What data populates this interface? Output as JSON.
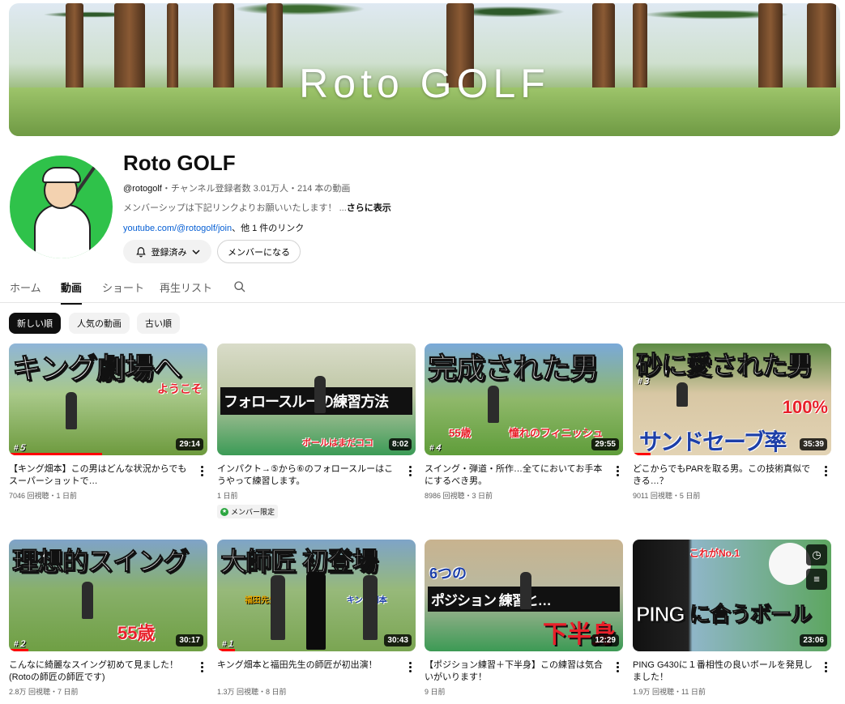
{
  "banner": {
    "title": "Roto GOLF"
  },
  "channel": {
    "name": "Roto GOLF",
    "handle": "@rotogolf",
    "stats": "・チャンネル登録者数 3.01万人・214 本の動画",
    "description": "メンバーシップは下記リンクよりお願いいたします！ ...",
    "more_label": "さらに表示",
    "link_url": "youtube.com/@rotogolf/join",
    "link_suffix": "、他 1 件のリンク",
    "subscribed_label": "登録済み",
    "member_label": "メンバーになる"
  },
  "tabs": [
    {
      "label": "ホーム",
      "active": false
    },
    {
      "label": "動画",
      "active": true
    },
    {
      "label": "ショート",
      "active": false
    },
    {
      "label": "再生リスト",
      "active": false
    }
  ],
  "chips": [
    {
      "label": "新しい順",
      "active": true
    },
    {
      "label": "人気の動画",
      "active": false
    },
    {
      "label": "古い順",
      "active": false
    }
  ],
  "videos": [
    {
      "thumb_text": "キング劇場へ",
      "thumb_sub": "ようこそ",
      "episode": "#５",
      "duration": "29:14",
      "title": "【キング畑本】この男はどんな状況からでもスーパーショットで…",
      "meta": "7046 回視聴・1 日前",
      "badge": ""
    },
    {
      "thumb_text": "フォロースルーの練習方法",
      "thumb_sub": "ボールはまだココ",
      "episode": "",
      "duration": "8:02",
      "title": "インパクト→⑤から⑥のフォロースルーはこうやって練習します。",
      "meta": "1 日前",
      "badge": "メンバー限定"
    },
    {
      "thumb_text": "完成された男",
      "thumb_sub": "憧れのフィニッシュ",
      "thumb_sub2": "55歳",
      "episode": "#４",
      "duration": "29:55",
      "title": "スイング・弾道・所作…全てにおいてお手本にするべき男。",
      "meta": "8986 回視聴・3 日前",
      "badge": ""
    },
    {
      "thumb_text": "砂に愛された男",
      "thumb_sub": "サンドセーブ率",
      "thumb_sub2": "100%",
      "episode": "#３",
      "duration": "35:39",
      "title": "どこからでもPARを取る男。この技術真似できる…？",
      "meta": "9011 回視聴・5 日前",
      "badge": ""
    },
    {
      "thumb_text": "理想的スイング",
      "thumb_sub": "55歳",
      "episode": "#２",
      "duration": "30:17",
      "title": "こんなに綺麗なスイング初めて見ました！(Rotoの師匠の師匠です)",
      "meta": "2.8万 回視聴・7 日前",
      "badge": ""
    },
    {
      "thumb_text": "大師匠 初登場",
      "thumb_sub": "福田先生",
      "thumb_sub2": "キング畑本",
      "episode": "#１",
      "duration": "30:43",
      "title": "キング畑本と福田先生の師匠が初出演！",
      "meta": "1.3万 回視聴・8 日前",
      "badge": ""
    },
    {
      "thumb_text": "ポジション 練習と…",
      "thumb_sub": "下半身",
      "thumb_sub2": "6つの",
      "episode": "",
      "duration": "12:29",
      "title": "【ポジション練習＋下半身】この練習は気合いがいります！",
      "meta": "9 日前",
      "badge": ""
    },
    {
      "thumb_text": "PING に合うボール",
      "thumb_sub": "これがNo.1",
      "episode": "",
      "duration": "23:06",
      "title": "PING G430に１番相性の良いボールを発見しました！",
      "meta": "1.9万 回視聴・11 日前",
      "badge": ""
    }
  ],
  "colors": {
    "accent_red": "#ff0000",
    "link_blue": "#065fd4",
    "member_green": "#2ba640"
  }
}
